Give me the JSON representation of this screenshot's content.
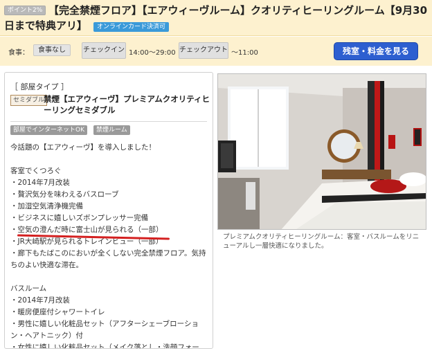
{
  "header": {
    "point_badge": "ポイント2%",
    "title_line1": "【完全禁煙フロア】【エアウィーヴルーム】クオリティヒーリングルーム【9月30",
    "title_line2": "日まで特典アリ】",
    "online_badge": "オンラインカード決済可"
  },
  "info": {
    "meal_label": "食事：",
    "meal_value": "食事なし",
    "checkin_label": "チェックイン",
    "checkin_value": "14:00～29:00",
    "checkout_label": "チェックアウト",
    "checkout_value": "～11:00",
    "cta_label": "残室・料金を見る"
  },
  "room": {
    "section_head": "［ 部屋タイプ ］",
    "plan_tag": "セミダブル",
    "plan_name": "禁煙【エアウィーヴ】プレミアムクオリティヒーリングセミダブル",
    "tags": [
      "部屋でインターネットOK",
      "禁煙ルーム"
    ],
    "description": "今話題の【エアウィーヴ】を導入しました！\n\n客室でくつろぐ\n・2014年7月改装\n・贅沢気分を味わえるバスローブ\n・加湿空気清浄機完備\n・ビジネスに嬉しいズボンプレッサー完備\n・空気の澄んだ時に富士山が見られる（一部）\n・JR大崎駅が見られるトレインビュー（一部）\n・廊下もたばこのにおいが全くしない完全禁煙フロア。気持ちのよい快適な滞在。\n\nバスルーム\n・2014年7月改装\n・暖房便座付シャワートイレ\n・男性に嬉しい化粧品セット（アフターシェーブローション・ヘアトニック）付\n・女性に嬉しい化粧品セット（メイク落とし・洗顔フォーム・保湿化粧水・乳液）やシャワーキャップ付"
  },
  "photo": {
    "caption": "プレミアムクオリティヒーリングルーム：客室・バスルームをリニューアルし一層快適になりました。"
  },
  "colors": {
    "header_bg": "#fdf1cf",
    "cta_bg": "#2d5fd0",
    "online_badge_bg": "#3a9ad9",
    "highlight_underline": "#d42020"
  }
}
